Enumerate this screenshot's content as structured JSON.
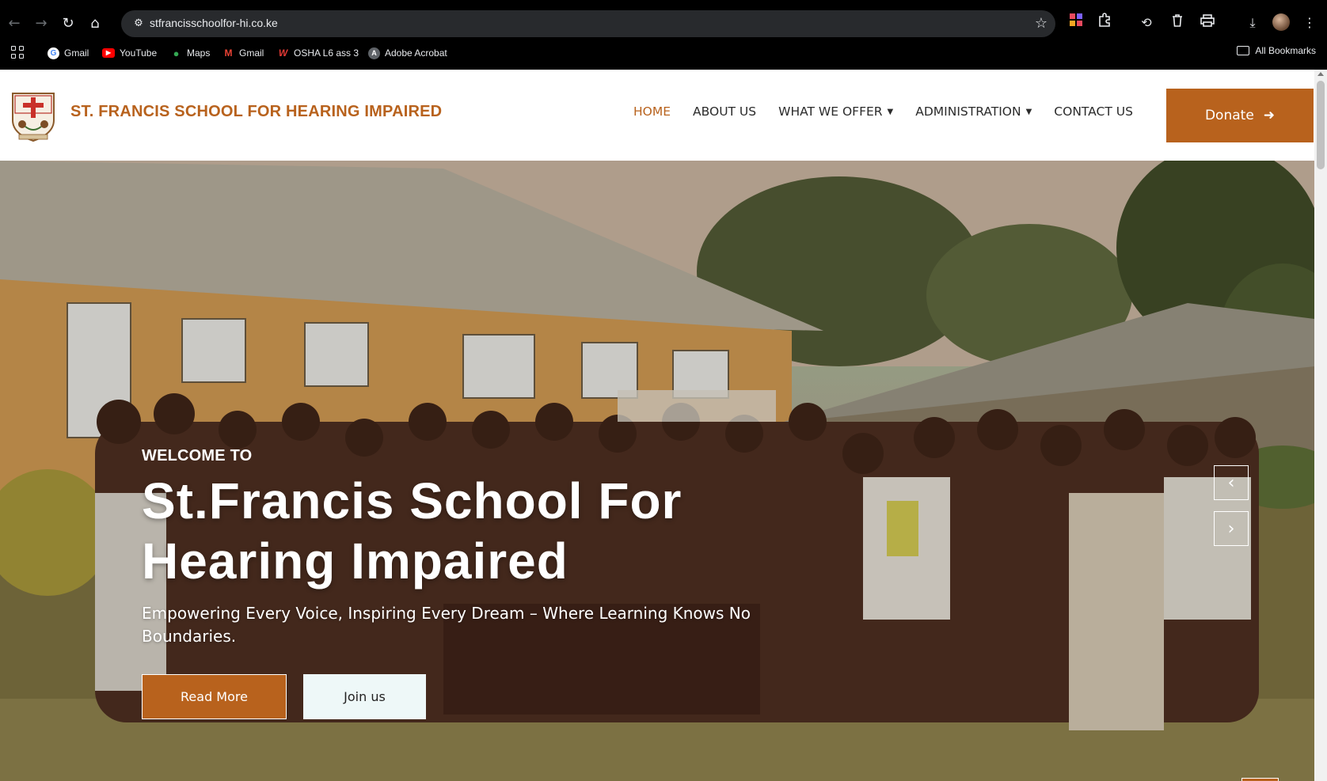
{
  "browser": {
    "url": "stfrancisschoolfor-hi.co.ke",
    "bookmarks": [
      {
        "label": "Gmail",
        "icon": "google-icon"
      },
      {
        "label": "YouTube",
        "icon": "youtube-icon"
      },
      {
        "label": "Maps",
        "icon": "maps-icon"
      },
      {
        "label": "Gmail",
        "icon": "gmail-icon"
      },
      {
        "label": "OSHA L6 ass 3",
        "icon": "w-icon"
      },
      {
        "label": "Adobe Acrobat",
        "icon": "acrobat-icon"
      }
    ],
    "all_bookmarks": "All Bookmarks"
  },
  "header": {
    "site_name": "ST. FRANCIS SCHOOL FOR HEARING IMPAIRED",
    "menu": [
      {
        "label": "HOME",
        "active": true
      },
      {
        "label": "ABOUT US"
      },
      {
        "label": "WHAT WE OFFER",
        "dropdown": true
      },
      {
        "label": "ADMINISTRATION",
        "dropdown": true
      },
      {
        "label": "CONTACT US"
      }
    ],
    "donate_label": "Donate"
  },
  "hero": {
    "eyebrow": "WELCOME TO",
    "title": "St.Francis School For Hearing Impaired",
    "subtitle": "Empowering Every Voice, Inspiring Every Dream – Where Learning Knows No Boundaries.",
    "read_more": "Read More",
    "join_us": "Join us",
    "prev_icon": "chevron-left-icon",
    "next_icon": "chevron-right-icon",
    "back_to_top_icon": "arrow-up-icon"
  },
  "colors": {
    "brand": "#b8621d",
    "browser_bg": "#000000",
    "omnibox": "#282a2d",
    "join_btn": "#eef8f8"
  }
}
